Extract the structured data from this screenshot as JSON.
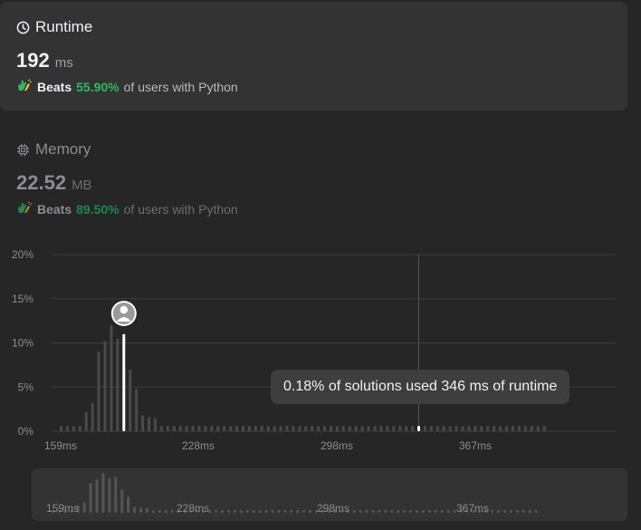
{
  "runtime": {
    "title": "Runtime",
    "value": "192",
    "unit": "ms",
    "beats_label": "Beats",
    "beats_pct": "55.90%",
    "beats_tail": "of users with Python"
  },
  "memory": {
    "title": "Memory",
    "value": "22.52",
    "unit": "MB",
    "beats_label": "Beats",
    "beats_pct": "89.50%",
    "beats_tail": "of users with Python"
  },
  "colors": {
    "accent_green": "#2cbb5d",
    "card_bg": "#333333",
    "page_bg": "#262626",
    "bar": "#4a4a4a",
    "highlight_bar": "#ffffff"
  },
  "icons": {
    "runtime": "clock-icon",
    "memory": "chip-icon",
    "beats": "clapping-hands-icon",
    "avatar": "user-avatar-icon"
  },
  "tooltip": "0.18% of solutions used 346 ms of runtime",
  "chart_data": {
    "type": "bar",
    "ylabel_ticks": [
      "20%",
      "15%",
      "10%",
      "5%",
      "0%"
    ],
    "ylim": [
      0,
      20
    ],
    "x_tick_labels": [
      "159ms",
      "228ms",
      "298ms",
      "367ms"
    ],
    "user_value_ms": 192,
    "hover_value_ms": 346,
    "values": [
      0.6,
      0.6,
      0.6,
      0.6,
      2.2,
      3.2,
      9.0,
      10.2,
      12.0,
      10.5,
      11.0,
      7.0,
      4.8,
      1.8,
      1.6,
      1.5,
      0.6,
      0.6,
      0.6,
      0.6,
      0.6,
      0.6,
      0.6,
      0.6,
      0.6,
      0.6,
      0.6,
      0.6,
      0.6,
      0.6,
      0.6,
      0.6,
      0.6,
      0.6,
      0.6,
      0.6,
      0.6,
      0.6,
      0.6,
      0.6,
      0.6,
      0.6,
      0.6,
      0.6,
      0.6,
      0.6,
      0.6,
      0.6,
      0.6,
      0.6,
      0.6,
      0.6,
      0.6,
      0.6,
      0.6,
      0.6,
      0.6,
      0.6,
      0.6,
      0.6,
      0.6,
      0.6,
      0.6,
      0.6,
      0.6,
      0.6,
      0.6,
      0.6,
      0.6,
      0.6,
      0.6,
      0.6,
      0.6,
      0.6,
      0.6,
      0.6,
      0.6,
      0.6
    ],
    "highlight_index": 10,
    "hover_index": 57
  }
}
